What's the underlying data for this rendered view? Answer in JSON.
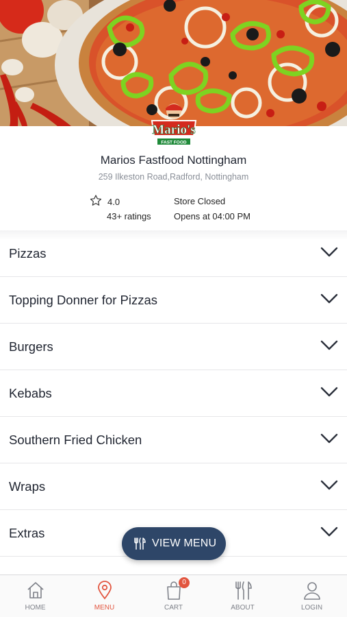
{
  "restaurant": {
    "logo_text": "Mario's",
    "logo_subtext": "FAST FOOD",
    "name": "Marios Fastfood Nottingham",
    "address": "259 Ilkeston Road,Radford, Nottingham",
    "rating": "4.0",
    "ratings_count": "43+ ratings",
    "status": "Store Closed",
    "opens": "Opens at 04:00 PM"
  },
  "categories": [
    {
      "label": "Pizzas"
    },
    {
      "label": "Topping Donner for Pizzas"
    },
    {
      "label": "Burgers"
    },
    {
      "label": "Kebabs"
    },
    {
      "label": "Southern Fried Chicken"
    },
    {
      "label": "Wraps"
    },
    {
      "label": "Extras"
    }
  ],
  "view_menu": {
    "label": "VIEW MENU",
    "icon": "cutlery-icon"
  },
  "nav": {
    "items": [
      {
        "label": "HOME",
        "icon": "home-icon"
      },
      {
        "label": "MENU",
        "icon": "location-pin-icon"
      },
      {
        "label": "CART",
        "icon": "cart-bag-icon"
      },
      {
        "label": "ABOUT",
        "icon": "cutlery-icon"
      },
      {
        "label": "LOGIN",
        "icon": "user-icon"
      }
    ],
    "active": "MENU",
    "cart_count": "0"
  },
  "colors": {
    "accent": "#e2553f",
    "button": "#2e4668",
    "text": "#1f2430",
    "muted": "#8a8f98"
  }
}
